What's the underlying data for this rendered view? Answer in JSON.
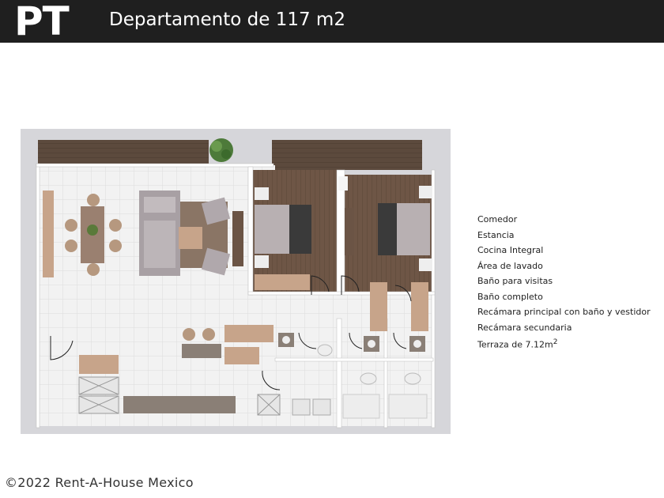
{
  "header": {
    "code": "PT",
    "title": "Departamento de 117 m2"
  },
  "legend": {
    "items": [
      "Comedor",
      "Estancia",
      "Cocina Integral",
      "Área de lavado",
      "Baño para visitas",
      "Baño completo",
      "Recámara principal con baño y vestidor",
      "Recámara secundaria"
    ],
    "terrace_label": "Terraza de 7.12m",
    "terrace_sup": "2"
  },
  "footer": {
    "copyright": "©2022 Rent-A-House Mexico"
  }
}
